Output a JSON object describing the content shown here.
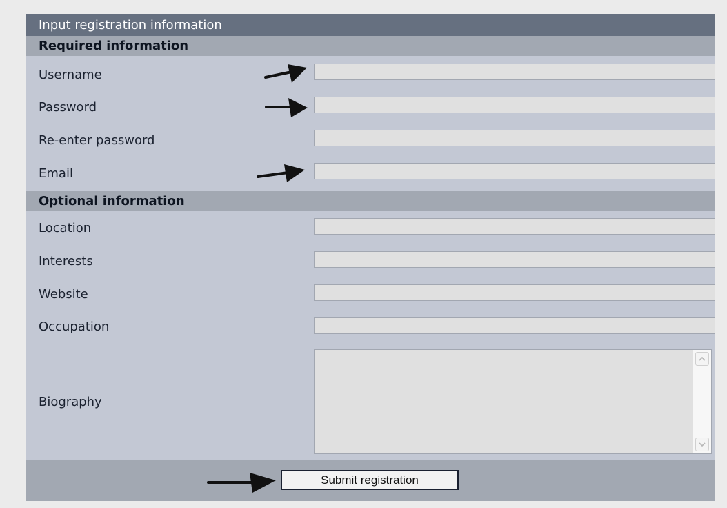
{
  "form": {
    "title": "Input registration information",
    "required_heading": "Required information",
    "optional_heading": "Optional information",
    "fields": {
      "username": {
        "label": "Username",
        "value": ""
      },
      "password": {
        "label": "Password",
        "value": ""
      },
      "reenter_password": {
        "label": "Re-enter password",
        "value": ""
      },
      "email": {
        "label": "Email",
        "value": ""
      },
      "location": {
        "label": "Location",
        "value": ""
      },
      "interests": {
        "label": "Interests",
        "value": ""
      },
      "website": {
        "label": "Website",
        "value": ""
      },
      "occupation": {
        "label": "Occupation",
        "value": ""
      },
      "biography": {
        "label": "Biography",
        "value": ""
      }
    },
    "submit_label": "Submit registration"
  },
  "annotations": {
    "arrow_icon": "right-arrow-icon",
    "arrow_color": "#111111",
    "pointed_fields": [
      "username",
      "password",
      "email",
      "submit"
    ]
  },
  "colors": {
    "page_background": "#ebebeb",
    "panel_background": "#c3c8d4",
    "title_bar": "#667080",
    "section_header": "#a2a8b2",
    "input_background": "#e0e0e0"
  }
}
